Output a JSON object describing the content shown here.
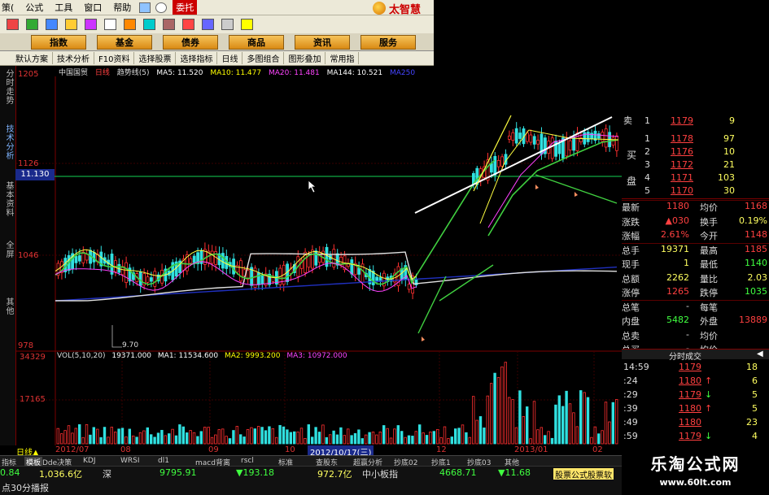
{
  "menu": {
    "items": [
      "策(",
      "公式",
      "工具",
      "窗口",
      "帮助"
    ],
    "entrust": "委托",
    "brand": "太智慧"
  },
  "nav": [
    "指数",
    "基金",
    "债券",
    "商品",
    "资讯",
    "服务"
  ],
  "tabs": [
    "默认方案",
    "技术分析",
    "F10资料",
    "选择股票",
    "选择指标",
    "日线",
    "多图组合",
    "图形叠加",
    "常用指"
  ],
  "sidetabs": [
    "分时走势",
    "技术分析",
    "基本资料",
    "全屏",
    "其他"
  ],
  "stock": {
    "name": "中国国贸",
    "period": "日线",
    "indicator": "趋势线(5)",
    "ma": [
      {
        "label": "MA5: 11.520",
        "color": "#ffffff"
      },
      {
        "label": "MA10: 11.477",
        "color": "#ffff00"
      },
      {
        "label": "MA20: 11.481",
        "color": "#ff40ff"
      },
      {
        "label": "MA144: 10.521",
        "color": "#ffffff"
      },
      {
        "label": "MA250",
        "color": "#4040ff"
      }
    ]
  },
  "price_scale": [
    "1205",
    "1126",
    "1046",
    "978"
  ],
  "current_price": "11.130",
  "low_label": "9.70",
  "volume": {
    "title": "VOL(5,10,20)",
    "items": [
      {
        "label": "19371.000",
        "color": "#ffffff"
      },
      {
        "label": "MA1: 11534.600",
        "color": "#ffffff"
      },
      {
        "label": "MA2: 9993.200",
        "color": "#ffff00"
      },
      {
        "label": "MA3: 10972.000",
        "color": "#ff40ff"
      }
    ],
    "scale": [
      "34329",
      "17165"
    ]
  },
  "orderbook": {
    "sell_label": "卖",
    "buy_label1": "买",
    "buy_label2": "盘",
    "rows": [
      {
        "lvl": "1",
        "price": "1179",
        "vol": "9"
      },
      {
        "lvl": "1",
        "price": "1178",
        "vol": "97"
      },
      {
        "lvl": "2",
        "price": "1176",
        "vol": "10"
      },
      {
        "lvl": "3",
        "price": "1172",
        "vol": "21"
      },
      {
        "lvl": "4",
        "price": "1171",
        "vol": "103"
      },
      {
        "lvl": "5",
        "price": "1170",
        "vol": "30"
      }
    ]
  },
  "quote": [
    {
      "l1": "最新",
      "v1": "1180",
      "c1": "#ff4040",
      "l2": "均价",
      "v2": "1168",
      "c2": "#ff4040"
    },
    {
      "l1": "涨跌",
      "v1": "▲030",
      "c1": "#ff4040",
      "l2": "换手",
      "v2": "0.19%",
      "c2": "#ffff60"
    },
    {
      "l1": "涨幅",
      "v1": "2.61%",
      "c1": "#ff4040",
      "l2": "今开",
      "v2": "1148",
      "c2": "#ff4040"
    },
    {
      "l1": "总手",
      "v1": "19371",
      "c1": "#ffff60",
      "l2": "最高",
      "v2": "1185",
      "c2": "#ff4040"
    },
    {
      "l1": "现手",
      "v1": "1",
      "c1": "#ffff60",
      "l2": "最低",
      "v2": "1140",
      "c2": "#40ff40"
    },
    {
      "l1": "总额",
      "v1": "2262",
      "c1": "#ffff60",
      "l2": "量比",
      "v2": "2.03",
      "c2": "#ffff60"
    },
    {
      "l1": "涨停",
      "v1": "1265",
      "c1": "#ff4040",
      "l2": "跌停",
      "v2": "1035",
      "c2": "#40ff40"
    },
    {
      "l1": "总笔",
      "v1": "-",
      "c1": "#dddddd",
      "l2": "每笔",
      "v2": "",
      "c2": "#dddddd"
    },
    {
      "l1": "内盘",
      "v1": "5482",
      "c1": "#40ff40",
      "l2": "外盘",
      "v2": "13889",
      "c2": "#ff4040"
    },
    {
      "l1": "总卖",
      "v1": "-",
      "c1": "#dddddd",
      "l2": "均价",
      "v2": "",
      "c2": "#dddddd"
    },
    {
      "l1": "总买",
      "v1": "-",
      "c1": "#dddddd",
      "l2": "均价",
      "v2": "",
      "c2": "#dddddd"
    }
  ],
  "ticks_header": "分时成交",
  "ticks": [
    {
      "t": "14:59",
      "p": "1179",
      "arrow": "",
      "v": "18",
      "pc": "#ff4040"
    },
    {
      "t": ":24",
      "p": "1180",
      "arrow": "↑",
      "v": "6",
      "pc": "#ff4040"
    },
    {
      "t": ":29",
      "p": "1179",
      "arrow": "↓",
      "v": "5",
      "pc": "#ff4040"
    },
    {
      "t": ":39",
      "p": "1180",
      "arrow": "↑",
      "v": "5",
      "pc": "#ff4040"
    },
    {
      "t": ":49",
      "p": "1180",
      "arrow": "",
      "v": "23",
      "pc": "#ff4040"
    },
    {
      "t": ":59",
      "p": "1179",
      "arrow": "↓",
      "v": "4",
      "pc": "#ff4040"
    }
  ],
  "date_axis": {
    "labels": [
      "日线▲",
      "2012/07",
      "08",
      "09",
      "10",
      "2012/10/17(三)",
      "12",
      "2013/01",
      "02"
    ]
  },
  "bottom_tabs": [
    "指标",
    "模板",
    "Dde决策",
    "KDJ",
    "WRSI",
    "dl1",
    "macd背离",
    "rscl",
    "标准",
    "查股东",
    "超赢分析",
    "抄底02",
    "抄底1",
    "抄底03",
    "其他"
  ],
  "status": {
    "v0": "0.84",
    "amt1": "1,036.6亿",
    "mkt": "深",
    "idx": "9795.91",
    "chg": "▼193.18",
    "amt2": "972.7亿",
    "board": "中小板指",
    "idx2": "4668.71",
    "chg2": "▼11.68",
    "promo": "股票公式股票软"
  },
  "status2": "点30分播报",
  "watermark": {
    "line1": "乐淘公式网",
    "line2": "www.60lt.com"
  }
}
